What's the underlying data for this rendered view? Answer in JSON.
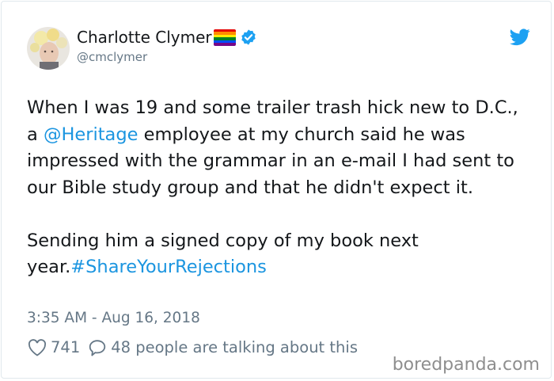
{
  "tweet": {
    "author": {
      "display_name": "Charlotte Clymer",
      "handle": "@cmclymer",
      "verified": true
    },
    "text": {
      "p1_before": "When I was 19 and some trailer trash hick new to D.C., a ",
      "mention": "@Heritage",
      "p1_after": " employee at my church said he was impressed with the grammar in an e-mail I had sent to our Bible study group and that he didn't expect it.",
      "p2_before": "Sending him a signed copy of my book next year.",
      "hashtag": "#ShareYourRejections"
    },
    "timestamp": "3:35 AM - Aug 16, 2018",
    "likes": "741",
    "talking": "48 people are talking about this"
  },
  "watermark": "boredpanda.com",
  "colors": {
    "link": "#1b95e0",
    "secondary_text": "#657786",
    "twitter_blue": "#1da1f2",
    "border": "#e1e8ed"
  },
  "icons": [
    "avatar",
    "rainbow-flag-icon",
    "verified-badge-icon",
    "twitter-bird-icon",
    "heart-icon",
    "reply-bubble-icon"
  ]
}
